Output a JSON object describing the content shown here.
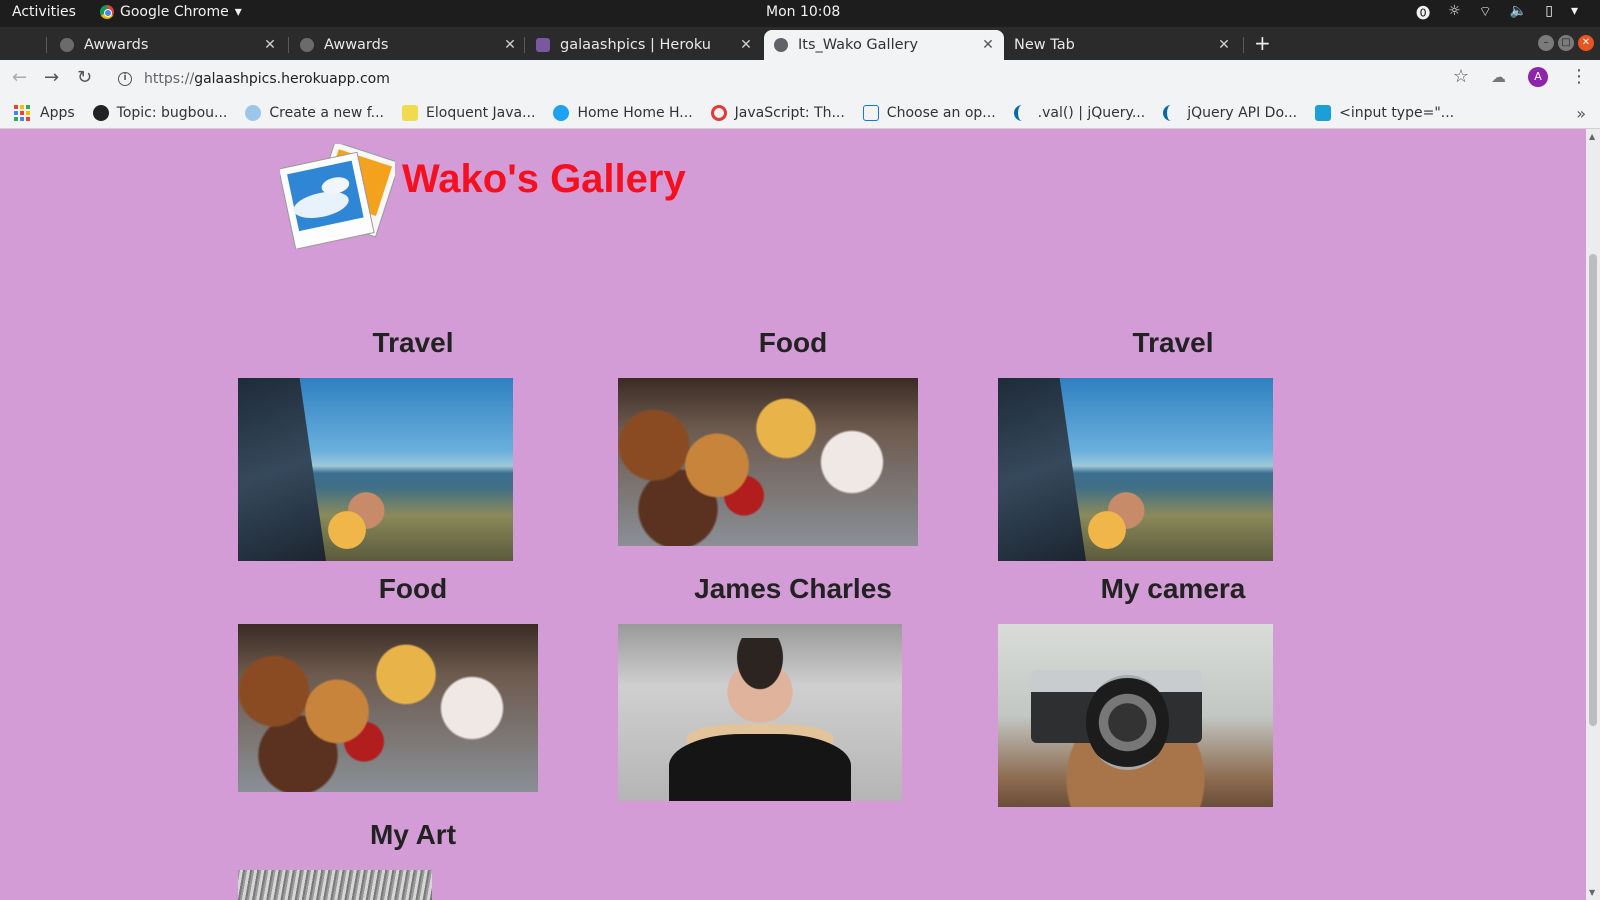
{
  "system_bar": {
    "activities": "Activities",
    "app_name": "Google Chrome",
    "clock": "Mon 10:08"
  },
  "tabs": [
    {
      "label": "Awwards",
      "active": false
    },
    {
      "label": "Awwards",
      "active": false
    },
    {
      "label": "galaashpics | Heroku",
      "active": false
    },
    {
      "label": "Its_Wako Gallery",
      "active": true
    },
    {
      "label": "New Tab",
      "active": false
    }
  ],
  "toolbar": {
    "url_protocol": "https://",
    "url_host": "galaashpics.herokuapp.com",
    "avatar_letter": "A"
  },
  "bookmarks": [
    {
      "label": "Apps",
      "icon": "apps-grid-icon"
    },
    {
      "label": "Topic: bugbou...",
      "icon": "github-icon"
    },
    {
      "label": "Create a new f...",
      "icon": "cloud-icon"
    },
    {
      "label": "Eloquent Java...",
      "icon": "ejs-icon"
    },
    {
      "label": "Home Home H...",
      "icon": "twitter-icon"
    },
    {
      "label": "JavaScript: Th...",
      "icon": "opera-icon"
    },
    {
      "label": "Choose an op...",
      "icon": "code-icon"
    },
    {
      "label": ".val() | jQuery...",
      "icon": "jquery-icon"
    },
    {
      "label": "jQuery API Do...",
      "icon": "jquery-icon"
    },
    {
      "label": "<input type=\"...",
      "icon": "mdn-icon"
    }
  ],
  "page": {
    "site_title": "Wako's Gallery",
    "gallery": [
      {
        "title": "Travel",
        "image": "travel-photo"
      },
      {
        "title": "Food",
        "image": "food-photo"
      },
      {
        "title": "Travel",
        "image": "travel-photo"
      },
      {
        "title": "Food",
        "image": "food-photo"
      },
      {
        "title": "James Charles",
        "image": "person-photo"
      },
      {
        "title": "My camera",
        "image": "camera-photo"
      },
      {
        "title": "My Art",
        "image": "art-photo"
      }
    ]
  },
  "colors": {
    "page_background": "#d39cd6",
    "title_color": "#f50f1f"
  }
}
